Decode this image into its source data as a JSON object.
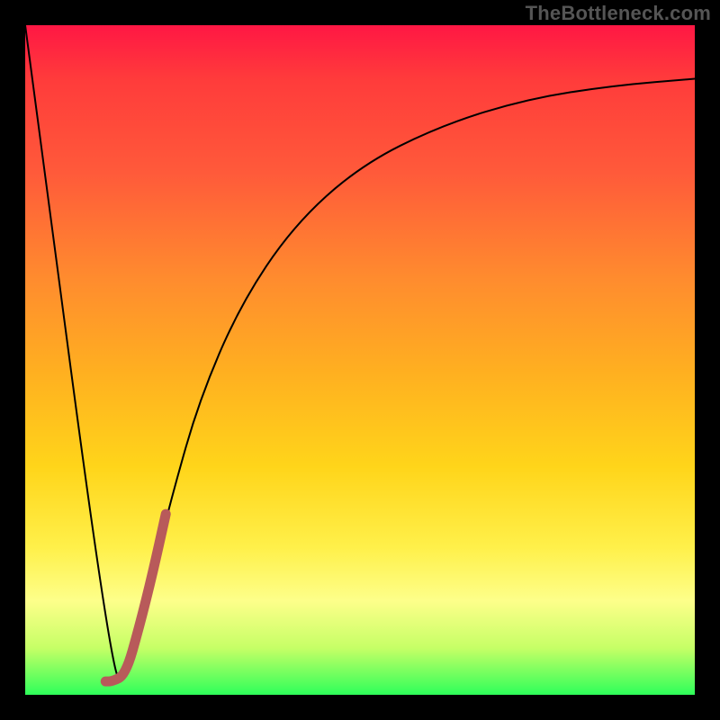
{
  "watermark": {
    "text": "TheBottleneck.com"
  },
  "chart_data": {
    "type": "line",
    "title": "",
    "xlabel": "",
    "ylabel": "",
    "xlim": [
      0,
      1
    ],
    "ylim": [
      0,
      1
    ],
    "grid": false,
    "legend": false,
    "annotations": [],
    "series": [
      {
        "name": "bottleneck-curve",
        "stroke": "#000000",
        "stroke_width": 2,
        "x": [
          0.0,
          0.13,
          0.15,
          0.17,
          0.19,
          0.22,
          0.26,
          0.32,
          0.4,
          0.5,
          0.62,
          0.75,
          0.88,
          1.0
        ],
        "values": [
          1.0,
          0.02,
          0.03,
          0.1,
          0.18,
          0.3,
          0.44,
          0.58,
          0.7,
          0.79,
          0.85,
          0.89,
          0.91,
          0.92
        ]
      },
      {
        "name": "highlight-segment",
        "stroke": "#b85a5a",
        "stroke_width": 11,
        "x": [
          0.12,
          0.13,
          0.15,
          0.17,
          0.19,
          0.21
        ],
        "values": [
          0.02,
          0.02,
          0.03,
          0.1,
          0.18,
          0.27
        ]
      }
    ],
    "background_gradient": {
      "direction": "top-to-bottom",
      "stops": [
        {
          "offset": 0.0,
          "color": "#ff1744"
        },
        {
          "offset": 0.38,
          "color": "#ff8c2e"
        },
        {
          "offset": 0.66,
          "color": "#ffd51a"
        },
        {
          "offset": 0.86,
          "color": "#fdff8a"
        },
        {
          "offset": 1.0,
          "color": "#2eff5a"
        }
      ]
    }
  }
}
